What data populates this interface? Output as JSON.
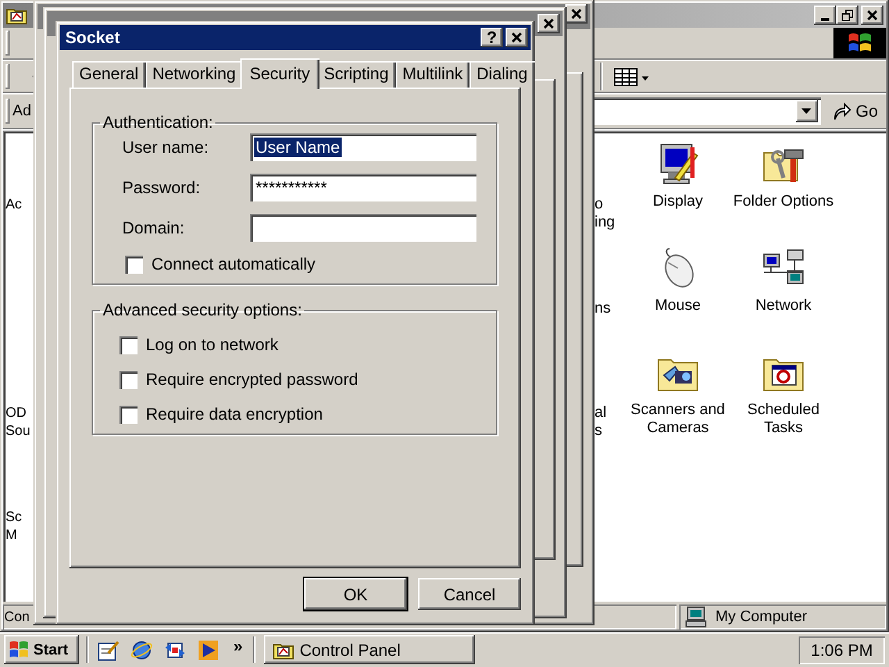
{
  "explorer": {
    "address_label": "Ad",
    "go_button": "Go",
    "rows": [
      {
        "left_fragment": [
          "Ac"
        ],
        "right_fragment": [
          "o",
          "ing"
        ],
        "icons": [
          {
            "label": "Display",
            "kind": "display"
          },
          {
            "label": "Folder Options",
            "kind": "folder-options"
          }
        ]
      },
      {
        "right_fragment": [
          "ns"
        ],
        "icons": [
          {
            "label": "Mouse",
            "kind": "mouse"
          },
          {
            "label": "Network",
            "kind": "network"
          }
        ]
      },
      {
        "left_fragment": [
          "OD",
          "Sou"
        ],
        "right_fragment": [
          "al",
          "s"
        ],
        "icons": [
          {
            "label": "Scanners and Cameras",
            "kind": "scanner"
          },
          {
            "label": "Scheduled Tasks",
            "kind": "tasks"
          }
        ]
      },
      {
        "left_fragment": [
          "Sc",
          "M"
        ]
      }
    ],
    "status_bar": {
      "left": "Con",
      "right": "My Computer"
    }
  },
  "dialog": {
    "title": "Socket",
    "help_button": "?",
    "tabs": [
      {
        "label": "General",
        "selected": false
      },
      {
        "label": "Networking",
        "selected": false
      },
      {
        "label": "Security",
        "selected": true
      },
      {
        "label": "Scripting",
        "selected": false
      },
      {
        "label": "Multilink",
        "selected": false
      },
      {
        "label": "Dialing",
        "selected": false
      }
    ],
    "groups": [
      {
        "legend": "Authentication:",
        "fields": [
          {
            "label": "User name:",
            "value": "User Name",
            "highlighted": true
          },
          {
            "label": "Password:",
            "value": "***********",
            "highlighted": false
          },
          {
            "label": "Domain:"
          }
        ],
        "checkboxes": [
          {
            "label": "Connect automatically",
            "checked": false
          }
        ]
      },
      {
        "legend": "Advanced security options:",
        "checkboxes": [
          {
            "label": "Log on to network",
            "checked": false
          },
          {
            "label": "Require encrypted password",
            "checked": false
          },
          {
            "label": "Require data encryption",
            "checked": false
          }
        ]
      }
    ],
    "buttons": [
      {
        "label": "OK",
        "default": true
      },
      {
        "label": "Cancel",
        "default": false
      }
    ]
  },
  "taskbar": {
    "start": "Start",
    "chevron": "»",
    "tasks": [
      {
        "label": "Control Panel",
        "selected": false
      }
    ],
    "clock": "1:06 PM"
  }
}
